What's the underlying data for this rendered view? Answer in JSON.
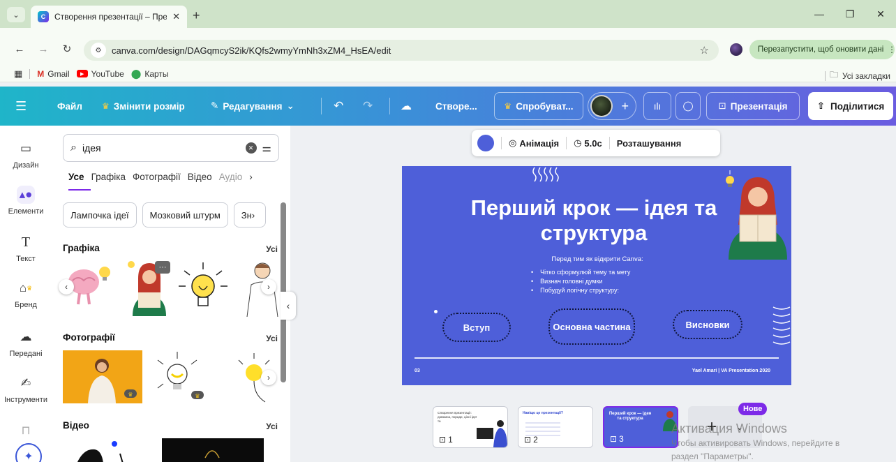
{
  "browser": {
    "tab_title": "Створення презентації – Презентація",
    "url": "canva.com/design/DAGqmcyS2ik/KQfs2wmyYmNh3xZM4_HsEA/edit",
    "update_button": "Перезапустити, щоб оновити дані",
    "bookmarks": [
      "Gmail",
      "YouTube",
      "Карты"
    ],
    "all_bookmarks": "Усі закладки"
  },
  "header": {
    "file": "Файл",
    "resize": "Змінити розмір",
    "editing": "Редагування",
    "doc_title": "Створе...",
    "try_pro": "Спробуват...",
    "present": "Презентація",
    "share": "Поділитися"
  },
  "rail": {
    "design": "Дизайн",
    "elements": "Елементи",
    "text": "Текст",
    "brand": "Бренд",
    "uploads": "Передані",
    "tools": "Інструменти"
  },
  "panel": {
    "search_value": "ідея",
    "categories": [
      "Усе",
      "Графіка",
      "Фотографії",
      "Відео",
      "Аудіо"
    ],
    "chips": [
      "Лампочка ідеї",
      "Мозковий штурм",
      "Зн"
    ],
    "sections": {
      "graphics": "Графіка",
      "photos": "Фотографії",
      "video": "Відео",
      "all": "Усі"
    }
  },
  "toolbar": {
    "animation": "Анімація",
    "duration": "5.0с",
    "position": "Розташування"
  },
  "slide": {
    "title": "Перший крок — ідея та структура",
    "intro": "Перед тим як відкрити Canva:",
    "bullets": [
      "Чітко сформулюй тему та мету",
      "Визнач головні думки",
      "Побудуй логічну структуру:"
    ],
    "pills": [
      "Вступ",
      "Основна частина",
      "Висновки"
    ],
    "number": "03",
    "footer": "Yael Amari | VA Presentation 2020",
    "bg_color": "#4e5fd9"
  },
  "pages": {
    "items": [
      {
        "num": "1",
        "title": "Створення презентації: довжина, поради, цінні ідеї та"
      },
      {
        "num": "2",
        "title": "Навіщо це презентації?"
      },
      {
        "num": "3",
        "title": "Перший крок — ідея та структура"
      }
    ],
    "new_badge": "Нове"
  },
  "watermark": {
    "title": "Активация Windows",
    "line1": "Чтобы активировать Windows, перейдите в",
    "line2": "раздел \"Параметры\"."
  },
  "colors": {
    "accent": "#7d2ae8",
    "slide_blue": "#4e5fd9",
    "header_start": "#1fb5c9",
    "header_end": "#6a5ce0"
  }
}
